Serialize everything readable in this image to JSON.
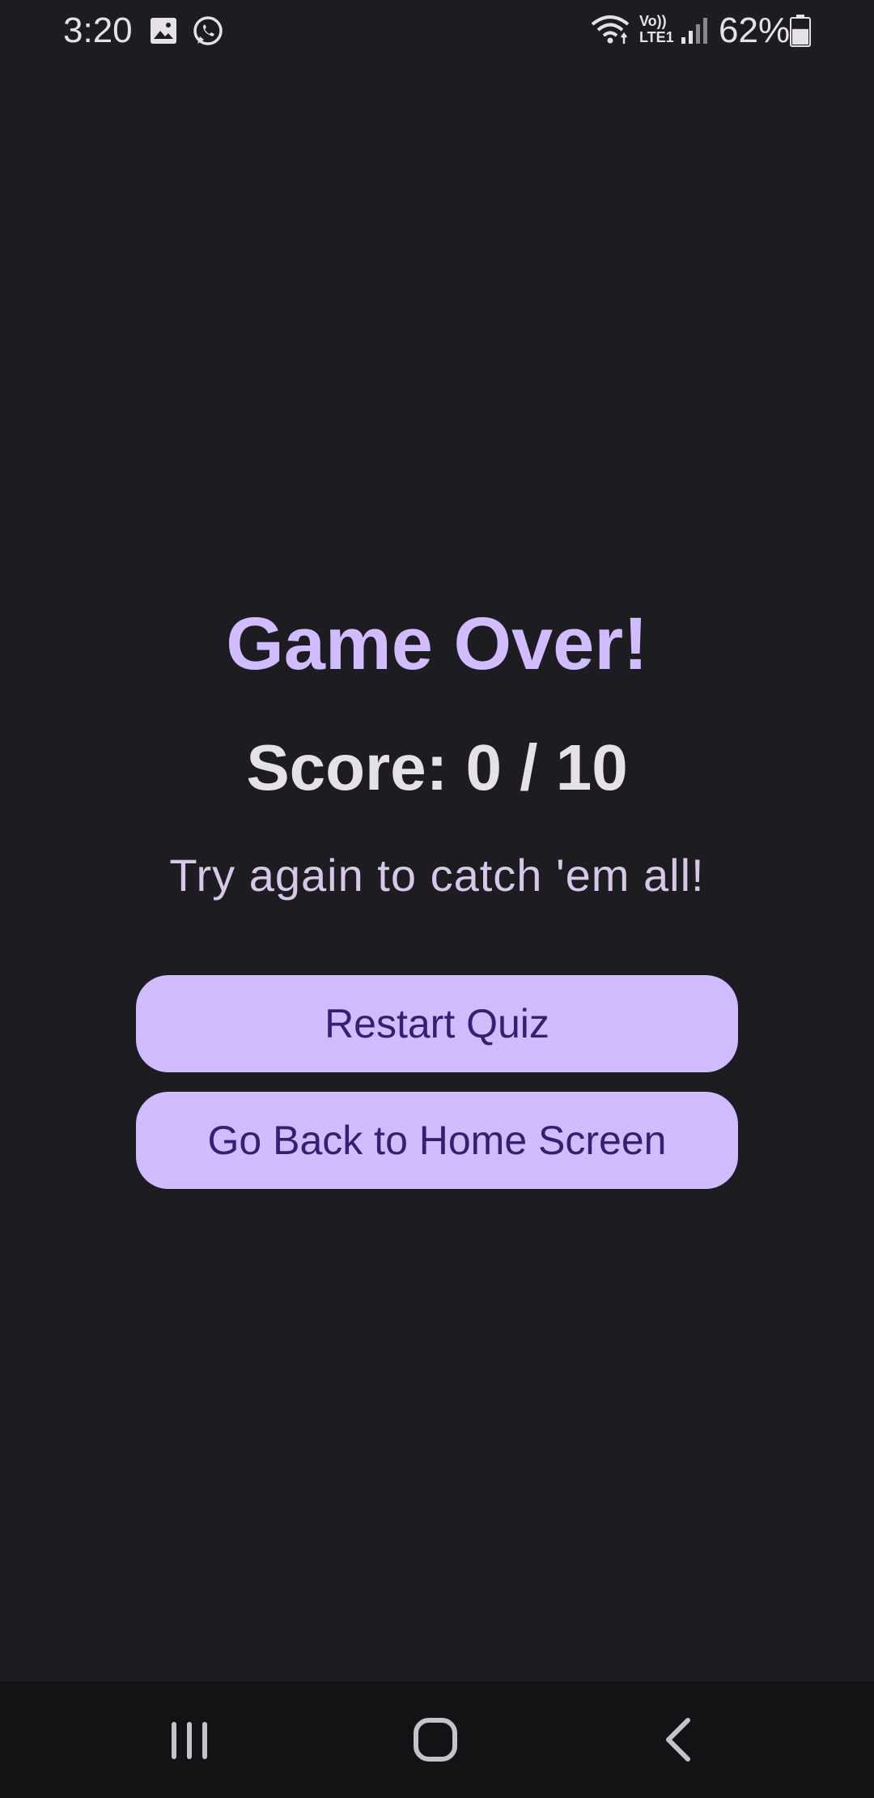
{
  "status_bar": {
    "time": "3:20",
    "notification_icons": [
      "image-icon",
      "whatsapp-icon"
    ],
    "system_icons": [
      "wifi-icon",
      "volte-lte-icon",
      "signal-icon",
      "battery-icon"
    ],
    "volte_label": "Vo))",
    "lte_label": "LTE1",
    "battery_percent": "62%",
    "battery_level": 0.62
  },
  "result": {
    "title": "Game Over!",
    "score": "Score: 0 / 10",
    "message": "Try again to catch 'em all!"
  },
  "actions": {
    "restart_label": "Restart Quiz",
    "home_label": "Go Back to Home Screen"
  },
  "nav_bar": {
    "icons": [
      "recents-icon",
      "home-icon",
      "back-icon"
    ]
  },
  "colors": {
    "background": "#1d1c21",
    "accent": "#d0bcff",
    "button_text": "#381e72",
    "nav_background": "#131316"
  }
}
